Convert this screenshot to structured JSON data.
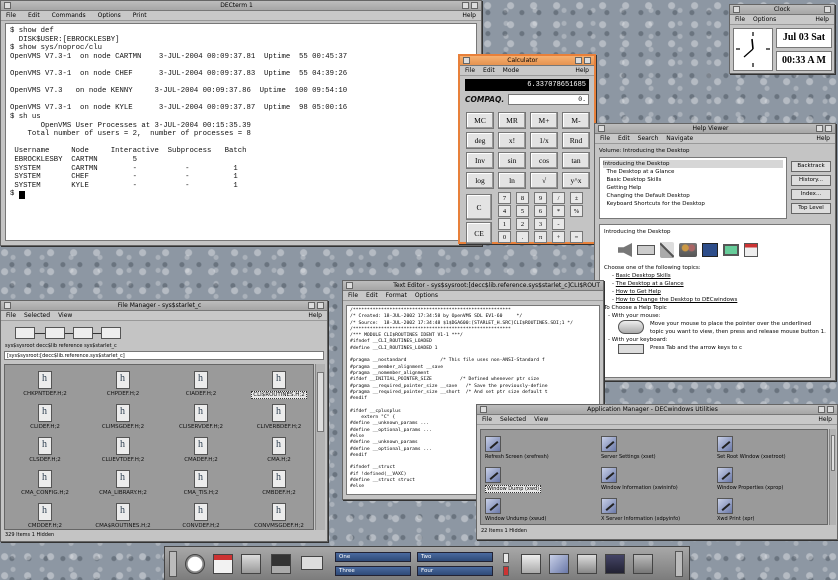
{
  "terminal": {
    "title": "DECterm 1",
    "menu": [
      "File",
      "Edit",
      "Commands",
      "Options",
      "Print"
    ],
    "help": "Help",
    "lines": [
      "$ show def",
      "  DISK$USER:[EBROCKLESBY]",
      "$ show sys/noproc/clu",
      "OpenVMS V7.3-1  on node CARTMN    3-JUL-2004 00:09:37.81  Uptime  55 00:45:37",
      "",
      "OpenVMS V7.3-1  on node CHEF      3-JUL-2004 00:09:37.83  Uptime  55 04:39:26",
      "",
      "OpenVMS V7.3   on node KENNY     3-JUL-2004 00:09:37.86  Uptime  100 09:54:10",
      "",
      "OpenVMS V7.3-1  on node KYLE      3-JUL-2004 00:09:37.87  Uptime  98 05:00:16",
      "$ sh us",
      "       OpenVMS User Processes at 3-JUL-2004 00:15:35.39",
      "    Total number of users = 2,  number of processes = 8",
      "",
      " Username     Node     Interactive  Subprocess   Batch",
      " EBROCKLESBY  CARTMN        5",
      " SYSTEM       CARTMN        -           -          1",
      " SYSTEM       CHEF          -           -          1",
      " SYSTEM       KYLE          -           -          1"
    ],
    "prompt": "$ "
  },
  "calculator": {
    "title": "Calculator",
    "menu": [
      "File",
      "Edit",
      "Mode"
    ],
    "help": "Help",
    "display": "6.337078651685",
    "brand": "COMPAQ.",
    "memory_display": "0.",
    "keys": [
      "MC",
      "MR",
      "M+",
      "M-",
      "deg",
      "x!",
      "1/x",
      "Rnd",
      "Inv",
      "sin",
      "cos",
      "tan",
      "log",
      "ln",
      "√",
      "y^x"
    ],
    "numpad": [
      "7",
      "8",
      "9",
      "/",
      "±",
      "4",
      "5",
      "6",
      "*",
      "%",
      "1",
      "2",
      "3",
      "-",
      "",
      "0",
      ".",
      "π",
      "+",
      "="
    ],
    "c_label": "C",
    "ce_label": "CE"
  },
  "clock": {
    "title": "Clock",
    "menu": [
      "File",
      "Options"
    ],
    "help": "Help",
    "date": "Jul 03 Sat",
    "time": "00:33 A M"
  },
  "help_viewer": {
    "title": "Help Viewer",
    "menu": [
      "File",
      "Edit",
      "Search",
      "Navigate"
    ],
    "help": "Help",
    "volume": "Volume: Introducing the Desktop",
    "topics": [
      "Introducing the Desktop",
      "  The Desktop at a Glance",
      "  Basic Desktop Skills",
      "  Getting Help",
      "  Changing the Default Desktop",
      "  Keyboard Shortcuts for the Desktop"
    ],
    "buttons": [
      "Backtrack",
      "History...",
      "Index...",
      "Top Level"
    ],
    "heading": "Introducing the Desktop",
    "choose": "Choose one of the following topics:",
    "links": [
      "Basic Desktop Skills",
      "The Desktop at a Glance",
      "How to Get Help",
      "How to Change the Desktop to DECwindows"
    ],
    "choose_topic": "To Choose a Help Topic",
    "with_mouse": "- With your mouse:",
    "mouse_text": "Move your mouse to place the pointer over the underlined topic you want to view, then press and release mouse button 1.",
    "with_keyboard": "- With your keyboard:",
    "key_text": "Press Tab and the arrow keys to c"
  },
  "file_manager": {
    "title": "File Manager - sys$starlet_c",
    "menu": [
      "File",
      "Selected",
      "View"
    ],
    "help": "Help",
    "path_label": "sys$sysroot decc$lib reference sys$starlet_c",
    "path_input": "[sys$sysroot:[decc$lib.reference.sys$starlet_c]",
    "files": [
      "CHKPNTDEF.H;2",
      "CHPDEF.H;2",
      "CIADEF.H;2",
      "CLI$ROUTINES.H;2",
      "CLIDEF.H;2",
      "CLIMSGDEF.H;2",
      "CLISERVDEF.H;2",
      "CLIVERBDEF.H;2",
      "CLSDEF.H;2",
      "CLUEVTDEF.H;2",
      "CMADEF.H;2",
      "CMA.H;2",
      "CMA_CONFIG.H;2",
      "CMA_LIBRARY.H;2",
      "CMA_TIS.H;2",
      "CMBDEF.H;2",
      "CMDDEF.H;2",
      "CMA$ROUTINES.H;2",
      "CONVDEF.H;2",
      "CONVMSGDEF.H;2"
    ],
    "status": "329 Items 1 Hidden"
  },
  "text_editor": {
    "title": "Text Editor - sys$sysroot:[decc$lib.reference.sys$starlet_c]CLI$ROUT",
    "menu": [
      "File",
      "Edit",
      "Format",
      "Options"
    ],
    "lines": [
      "/********************************************************",
      "/* Created: 18-JUL-2002 17:34:58 by OpenVMS SDL EV1-60     */",
      "/* Source:  18-JUL-2002 17:34:48 $1$DGA600:[STARLET_H.SRC]CLI$ROUTINES.SDI;1 */",
      "/********************************************************",
      "/*** MODULE CLI$ROUTINES IDENT V1-1 ***/",
      "#ifndef __CLI_ROUTINES_LOADED",
      "#define __CLI_ROUTINES_LOADED 1",
      "",
      "#pragma __nostandard            /* This file uses non-ANSI-Standard f",
      "#pragma __member_alignment __save",
      "#pragma __nomember_alignment",
      "#ifdef __INITIAL_POINTER_SIZE          /* Defined whenever ptr size",
      "#pragma __required_pointer_size __save   /* Save the previously-define",
      "#pragma __required_pointer_size __short  /* And set ptr size default t",
      "#endif",
      "",
      "#ifdef __cplusplus",
      "    extern \"C\" {",
      "#define __unknown_params ...",
      "#define __optional_params ...",
      "#else",
      "#define __unknown_params",
      "#define __optional_params ...",
      "#endif",
      "",
      "#ifndef __struct",
      "#if !defined(__VAXC)",
      "#define __struct struct",
      "#else"
    ]
  },
  "app_manager": {
    "title": "Application Manager - DECwindows Utilities",
    "menu": [
      "File",
      "Selected",
      "View"
    ],
    "help": "Help",
    "items": [
      "Refresh Screen (xrefresh)",
      "Server Settings (xset)",
      "Set Root Window (xsetroot)",
      "Window Dump (xwd)",
      "Window Information (xwininfo)",
      "Window Properties (xprop)",
      "Window Undump (xwud)",
      "X Server Information (xdpyinfo)",
      "Xwd Print (xpr)"
    ],
    "status": "22 Items 1 Hidden"
  },
  "dock": {
    "workspaces": [
      "One",
      "Two",
      "Three",
      "Four"
    ]
  }
}
